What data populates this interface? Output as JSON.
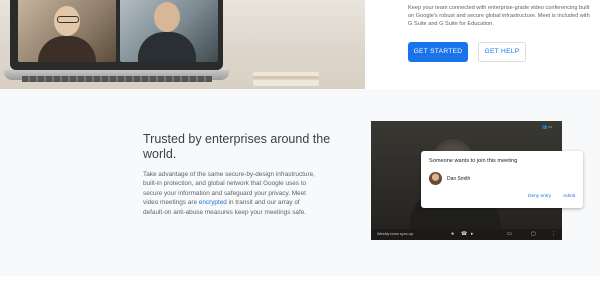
{
  "hero": {
    "description": "Keep your team connected with enterprise-grade video conferencing built on Google's robust and secure global infrastructure. Meet is included with G Suite and G Suite for Education.",
    "get_started_label": "GET STARTED",
    "get_help_label": "GET HELP"
  },
  "trust_section": {
    "title": "Trusted by enterprises around the world.",
    "body_before_link": "Take advantage of the same secure-by-design infrastructure, built-in protection, and global network that Google uses to secure your information and safeguard your privacy. Meet video meetings are ",
    "link_text": "encrypted",
    "body_after_link": " in transit and our array of default-on anti-abuse measures keep your meetings safe."
  },
  "meeting_preview": {
    "room_name": "Weekly team sync-up",
    "join_dialog": {
      "title": "Someone wants to join this meeting",
      "requester_name": "Dan Smith",
      "deny_label": "Deny entry",
      "admit_label": "Admit"
    }
  },
  "colors": {
    "accent": "#1a73e8",
    "band_background": "#f8f9fa",
    "heading_text": "#3c4043",
    "body_text": "#5f6368"
  }
}
